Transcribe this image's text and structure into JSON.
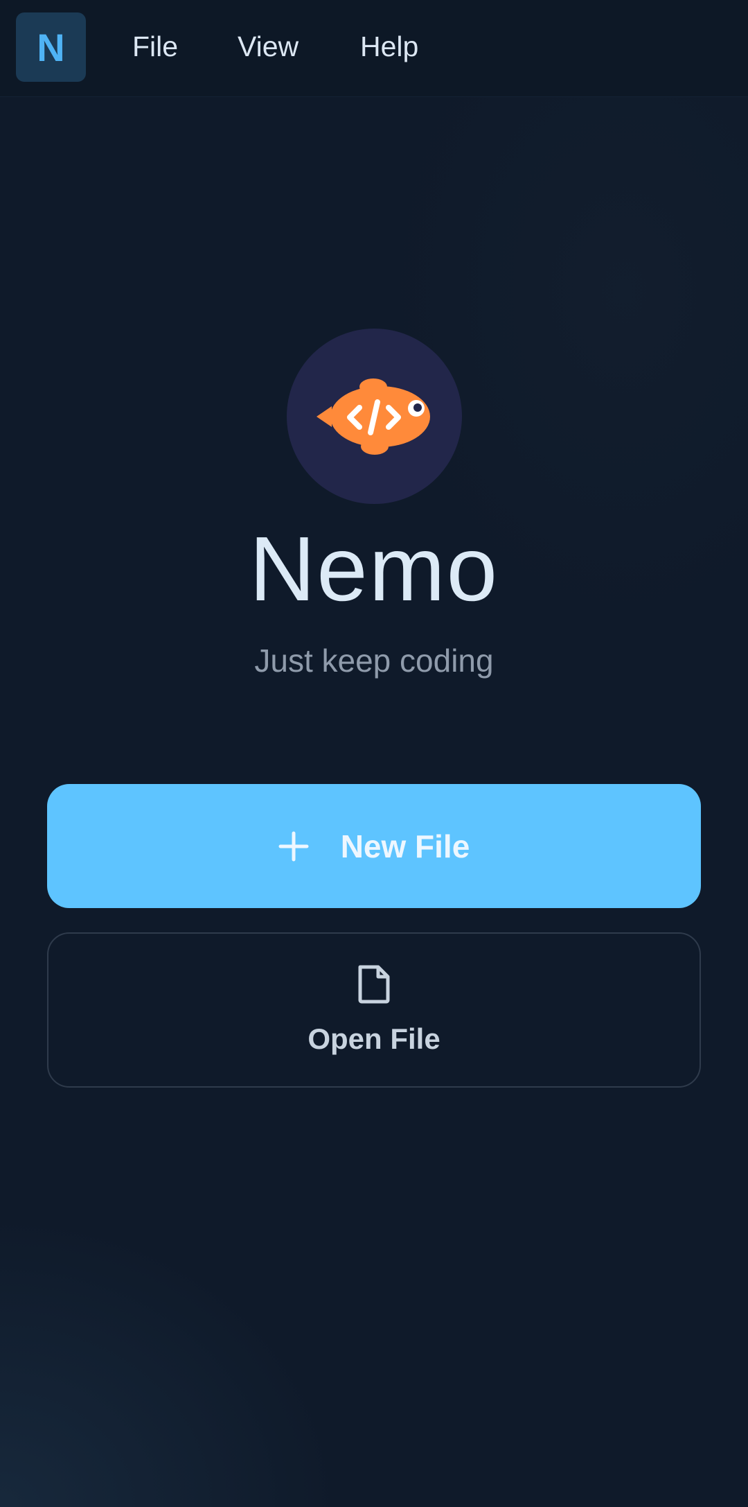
{
  "menubar": {
    "app_badge": "N",
    "items": [
      {
        "label": "File"
      },
      {
        "label": "View"
      },
      {
        "label": "Help"
      }
    ]
  },
  "hero": {
    "logo_icon": "clownfish-code-icon",
    "app_name": "Nemo",
    "tagline": "Just keep coding"
  },
  "actions": {
    "new_file": {
      "label": "New File",
      "icon": "plus-icon"
    },
    "open_file": {
      "label": "Open File",
      "icon": "file-icon"
    }
  },
  "colors": {
    "background": "#0f1a2a",
    "menubar": "#0d1826",
    "accent": "#5ec4ff",
    "badge_bg": "#1b3a55",
    "badge_text": "#4fb3f5",
    "logo_circle": "#22264a",
    "fish": "#ff8a3a"
  }
}
